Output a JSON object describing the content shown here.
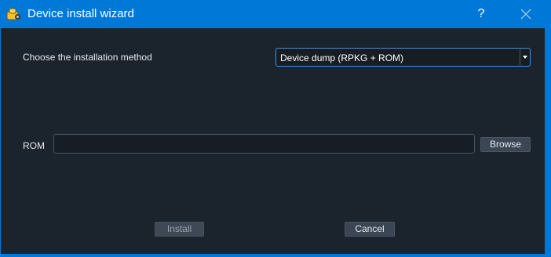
{
  "window": {
    "title": "Device install wizard",
    "icon": "device-app-icon",
    "help_label": "?",
    "close_icon": "close-icon"
  },
  "form": {
    "method_label": "Choose the installation method",
    "method_selected": "Device dump (RPKG + ROM)",
    "rom_label": "ROM",
    "rom_value": "",
    "browse_label": "Browse"
  },
  "buttons": {
    "install_label": "Install",
    "install_enabled": false,
    "cancel_label": "Cancel"
  },
  "colors": {
    "titlebar": "#0078d7",
    "client_bg": "#1b232c",
    "accent_border": "#4a90d9"
  }
}
